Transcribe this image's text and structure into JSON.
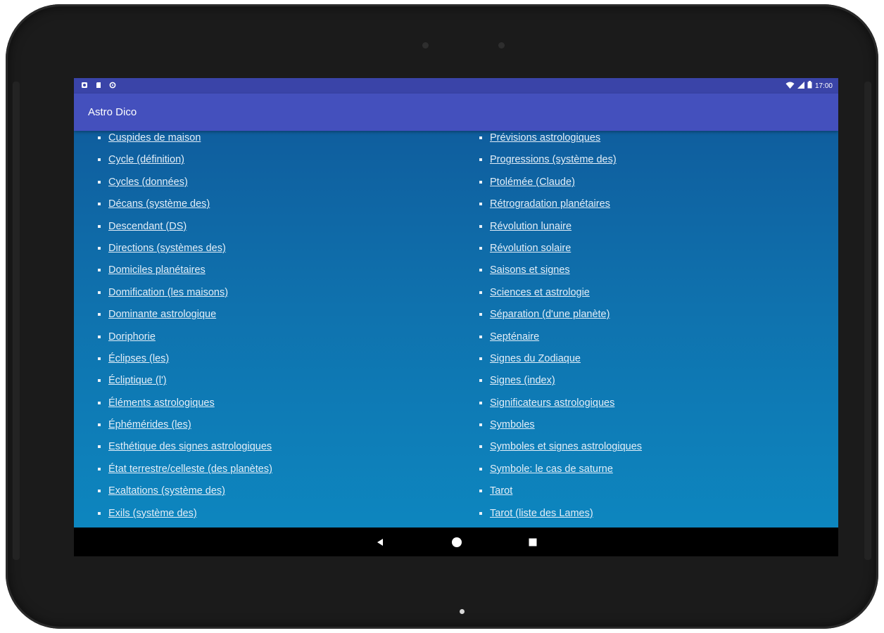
{
  "status_bar": {
    "time": "17:00",
    "left_icons": [
      "settings-icon",
      "sd-card-icon",
      "sync-icon"
    ],
    "right_icons": [
      "wifi-icon",
      "signal-icon",
      "battery-icon"
    ]
  },
  "app_bar": {
    "title": "Astro Dico"
  },
  "left_column": [
    "Cuspides de maison",
    "Cycle (définition)",
    "Cycles (données)",
    "Décans (système des)",
    "Descendant (DS)",
    "Directions (systèmes des)",
    "Domiciles planétaires",
    "Domification (les maisons)",
    "Dominante astrologique",
    "Doriphorie",
    "Éclipses (les)",
    "Écliptique (l')",
    "Éléments astrologiques",
    "Éphémérides (les)",
    "Esthétique des signes astrologiques",
    "État terrestre/celleste (des planètes)",
    "Exaltations (système des)",
    "Exils (système des)"
  ],
  "right_column": [
    "Prévisions astrologiques",
    "Progressions (système des)",
    "Ptolémée (Claude)",
    "Rétrogradation planétaires",
    "Révolution lunaire",
    "Révolution solaire",
    "Saisons et signes",
    "Sciences et astrologie",
    "Séparation (d'une planète)",
    "Septénaire",
    "Signes du Zodiaque",
    "Signes (index)",
    "Significateurs astrologiques",
    "Symboles",
    "Symboles et signes astrologiques",
    "Symbole: le cas de saturne",
    "Tarot",
    "Tarot (liste des Lames)"
  ],
  "nav_bar": {
    "buttons": [
      "back-icon",
      "home-icon",
      "recent-apps-icon"
    ]
  },
  "colors": {
    "status_bar": "#3a44a8",
    "app_bar": "#4450bd",
    "content_top": "#0f5e9e",
    "content_bottom": "#0d86bf",
    "link": "#e3eef8"
  }
}
